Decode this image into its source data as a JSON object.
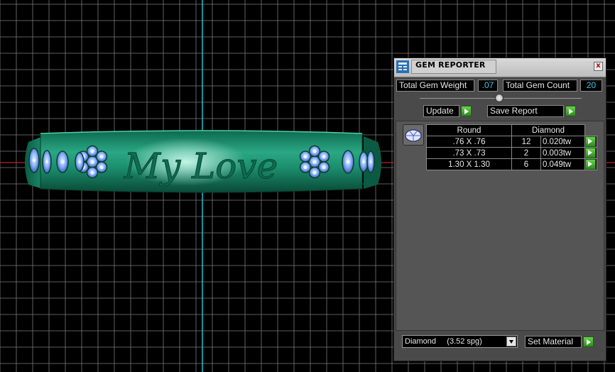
{
  "viewport": {
    "ring_engraving": "My Love",
    "colors": {
      "background": "#000000",
      "grid": "#7a7a7a",
      "axis_vertical": "#1fc3d6",
      "axis_horizontal": "#c0202a",
      "metal": "#1e8f6e",
      "gem": "#7fb5ff"
    }
  },
  "panel": {
    "title": "GEM REPORTER",
    "close_label": "x",
    "total_weight_label": "Total Gem Weight",
    "total_weight_value": ".07",
    "total_count_label": "Total Gem Count",
    "total_count_value": "20",
    "update_label": "Update",
    "save_report_label": "Save Report",
    "table": {
      "shape_header": "Round",
      "material_header": "Diamond",
      "rows": [
        {
          "size": ".76 X .76",
          "count": "12",
          "weight": "0.020tw"
        },
        {
          "size": ".73 X .73",
          "count": "2",
          "weight": "0.003tw"
        },
        {
          "size": "1.30 X 1.30",
          "count": "6",
          "weight": "0.049tw"
        }
      ]
    },
    "material_select_value": "Diamond     (3.52 spg)",
    "set_material_label": "Set Material"
  }
}
